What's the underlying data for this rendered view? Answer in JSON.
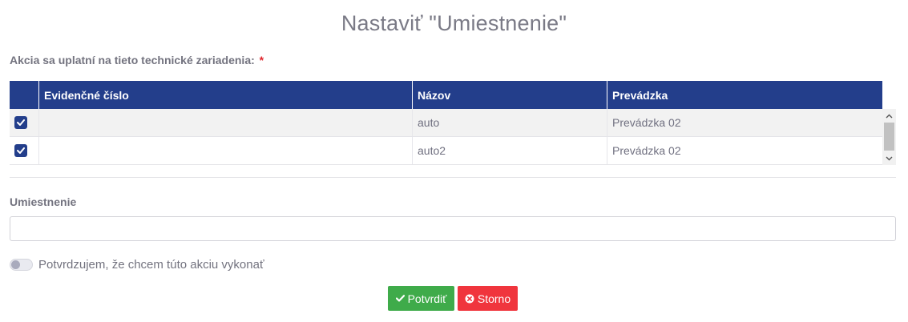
{
  "dialog": {
    "title": "Nastaviť \"Umiestnenie\""
  },
  "devices_section": {
    "label": "Akcia sa uplatní na tieto technické zariadenia:",
    "required_mark": "*"
  },
  "table": {
    "columns": [
      "",
      "Evidenčné číslo",
      "Názov",
      "Prevádzka"
    ],
    "rows": [
      {
        "checked": true,
        "evidencne_cislo": "",
        "nazov": "auto",
        "prevadzka": "Prevádzka 02"
      },
      {
        "checked": true,
        "evidencne_cislo": "",
        "nazov": "auto2",
        "prevadzka": "Prevádzka 02"
      }
    ]
  },
  "location_field": {
    "label": "Umiestnenie",
    "value": "",
    "placeholder": ""
  },
  "confirm_toggle": {
    "label": "Potvrdzujem, že chcem túto akciu vykonať",
    "checked": false
  },
  "buttons": {
    "confirm_label": "Potvrdiť",
    "cancel_label": "Storno"
  },
  "colors": {
    "header_bg": "#233e8b",
    "confirm_bg": "#3fab4a",
    "cancel_bg": "#f0353d",
    "required": "#e0262c"
  },
  "icons": {
    "row_checkbox": "checkbox-checked-icon",
    "confirm": "check-icon",
    "cancel": "times-circle-icon"
  }
}
